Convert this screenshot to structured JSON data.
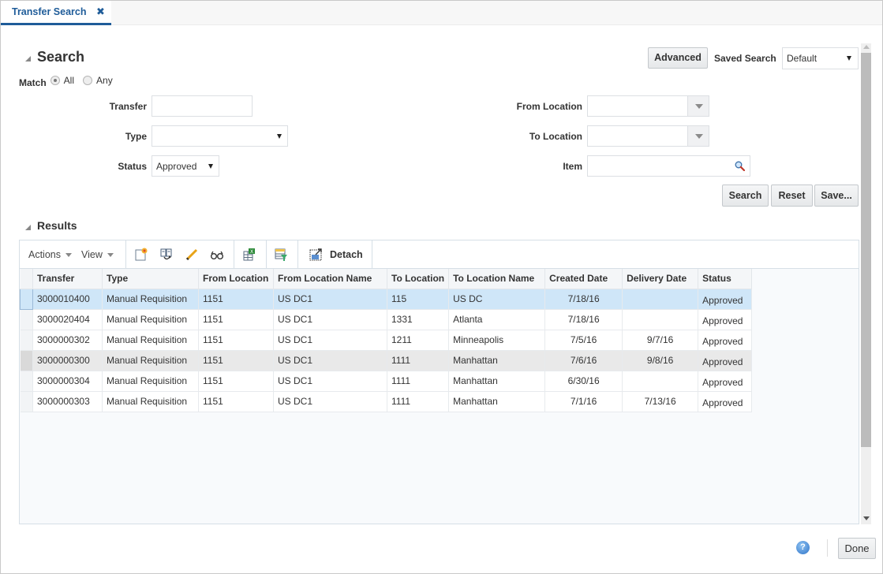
{
  "tab": {
    "label": "Transfer Search",
    "close": "✖"
  },
  "search": {
    "title": "Search",
    "advanced_label": "Advanced",
    "saved_search_label": "Saved Search",
    "saved_search_value": "Default",
    "match_label": "Match",
    "match_options": [
      "All",
      "Any"
    ],
    "match_selected": "All",
    "fields": {
      "transfer": {
        "label": "Transfer",
        "value": ""
      },
      "type": {
        "label": "Type",
        "value": ""
      },
      "status": {
        "label": "Status",
        "value": "Approved"
      },
      "from_location": {
        "label": "From Location",
        "value": ""
      },
      "to_location": {
        "label": "To Location",
        "value": ""
      },
      "item": {
        "label": "Item",
        "value": ""
      }
    },
    "buttons": {
      "search": "Search",
      "reset": "Reset",
      "save": "Save..."
    }
  },
  "results": {
    "title": "Results",
    "toolbar": {
      "actions": "Actions",
      "view": "View",
      "detach": "Detach",
      "icons": [
        "create-icon",
        "split-icon",
        "edit-icon",
        "view-icon",
        "export-excel-icon",
        "query-by-example-icon",
        "detach-icon"
      ]
    },
    "columns": [
      "Transfer",
      "Type",
      "From Location",
      "From Location Name",
      "To Location",
      "To Location Name",
      "Created Date",
      "Delivery Date",
      "Status"
    ],
    "rows": [
      [
        "3000010400",
        "Manual Requisition",
        "1151",
        "US DC1",
        "115",
        "US DC",
        "7/18/16",
        "",
        "Approved"
      ],
      [
        "3000020404",
        "Manual Requisition",
        "1151",
        "US DC1",
        "1331",
        "Atlanta",
        "7/18/16",
        "",
        "Approved"
      ],
      [
        "3000000302",
        "Manual Requisition",
        "1151",
        "US DC1",
        "1211",
        "Minneapolis",
        "7/5/16",
        "9/7/16",
        "Approved"
      ],
      [
        "3000000300",
        "Manual Requisition",
        "1151",
        "US DC1",
        "1111",
        "Manhattan",
        "7/6/16",
        "9/8/16",
        "Approved"
      ],
      [
        "3000000304",
        "Manual Requisition",
        "1151",
        "US DC1",
        "1111",
        "Manhattan",
        "6/30/16",
        "",
        "Approved"
      ],
      [
        "3000000303",
        "Manual Requisition",
        "1151",
        "US DC1",
        "1111",
        "Manhattan",
        "7/1/16",
        "7/13/16",
        "Approved"
      ]
    ],
    "selected_row": 0,
    "hover_row": 3
  },
  "footer": {
    "help": "?",
    "done": "Done"
  }
}
